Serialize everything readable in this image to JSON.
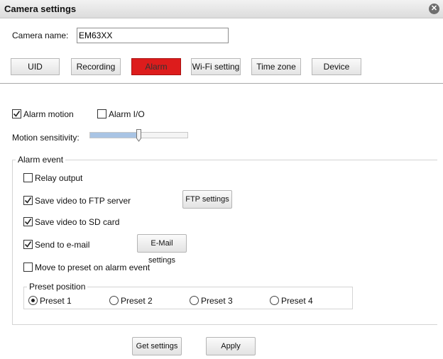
{
  "window": {
    "title": "Camera settings",
    "close_icon": "close-icon"
  },
  "camera_name": {
    "label": "Camera name:",
    "value": "EM63XX"
  },
  "tabs": [
    {
      "label": "UID",
      "active": false
    },
    {
      "label": "Recording",
      "active": false
    },
    {
      "label": "Alarm",
      "active": true
    },
    {
      "label": "Wi-Fi setting",
      "active": false
    },
    {
      "label": "Time zone",
      "active": false
    },
    {
      "label": "Device",
      "active": false
    }
  ],
  "alarm": {
    "alarm_motion": {
      "label": "Alarm motion",
      "checked": true
    },
    "alarm_io": {
      "label": "Alarm I/O",
      "checked": false
    },
    "motion_sensitivity": {
      "label": "Motion sensitivity:",
      "level": 0.5
    }
  },
  "alarm_event": {
    "legend": "Alarm event",
    "relay_output": {
      "label": "Relay output",
      "checked": false
    },
    "save_ftp": {
      "label": "Save video to FTP server",
      "checked": true
    },
    "ftp_settings_label": "FTP settings",
    "save_sd": {
      "label": "Save video to SD card",
      "checked": true
    },
    "send_email": {
      "label": "Send to e-mail",
      "checked": true
    },
    "email_settings_label": "E-Mail settings",
    "move_preset": {
      "label": "Move to preset on alarm event",
      "checked": false
    },
    "preset_position": {
      "legend": "Preset position",
      "options": [
        {
          "label": "Preset 1",
          "selected": true
        },
        {
          "label": "Preset 2",
          "selected": false
        },
        {
          "label": "Preset 3",
          "selected": false
        },
        {
          "label": "Preset 4",
          "selected": false
        }
      ]
    }
  },
  "footer": {
    "get_settings_label": "Get settings",
    "apply_label": "Apply"
  },
  "colors": {
    "active_tab": "#dd1c1c",
    "slider_fill": "#a9c4e4"
  }
}
